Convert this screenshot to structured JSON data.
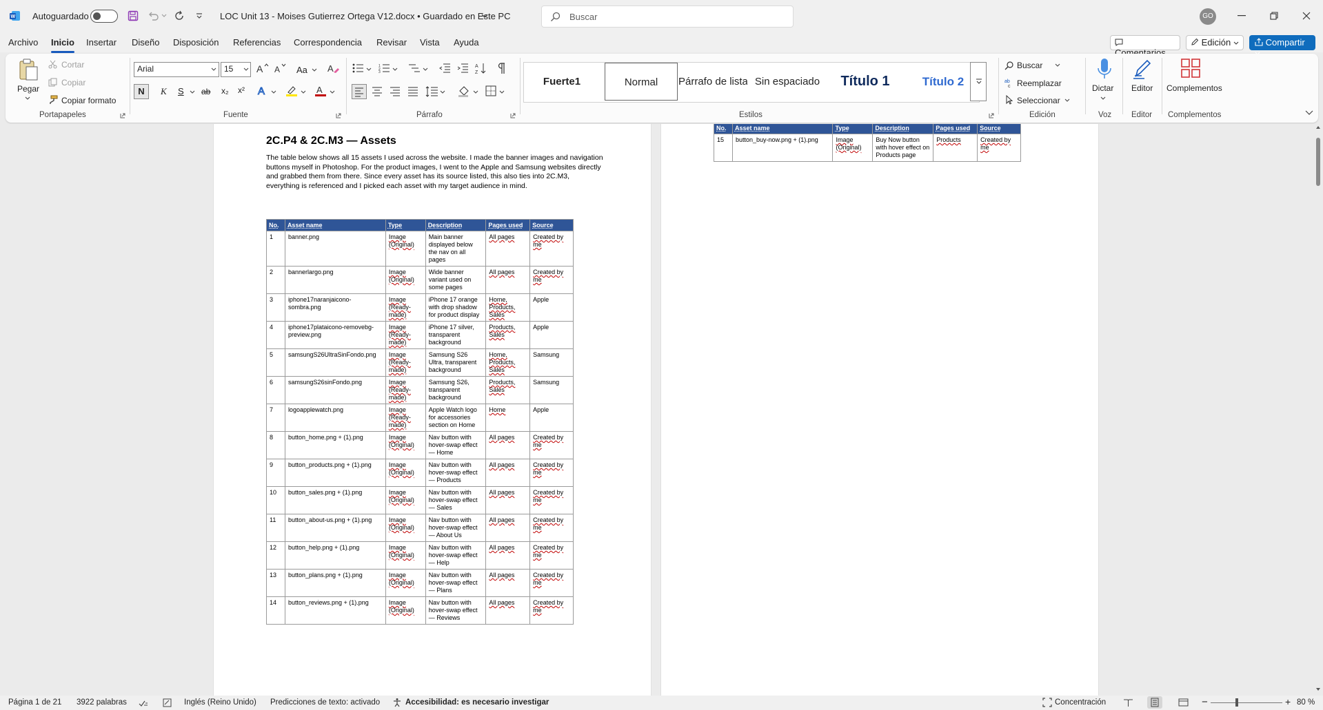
{
  "titlebar": {
    "autosave_label": "Autoguardado",
    "doc_title": "LOC Unit 13 - Moises Gutierrez Ortega V12.docx • Guardado en Este PC",
    "search_placeholder": "Buscar",
    "avatar_initials": "GO"
  },
  "menu": {
    "items": [
      "Archivo",
      "Inicio",
      "Insertar",
      "Diseño",
      "Disposición",
      "Referencias",
      "Correspondencia",
      "Revisar",
      "Vista",
      "Ayuda"
    ],
    "comments": "Comentarios",
    "editing": "Edición",
    "share": "Compartir"
  },
  "ribbon": {
    "paste": "Pegar",
    "cut": "Cortar",
    "copy": "Copiar",
    "format_painter": "Copiar formato",
    "group_clipboard": "Portapapeles",
    "font_name": "Arial",
    "font_size": "15",
    "change_case": "Aa",
    "bold": "N",
    "italic": "K",
    "underline": "S",
    "strike": "ab",
    "subscript": "x₂",
    "superscript": "x²",
    "group_font": "Fuente",
    "group_paragraph": "Párrafo",
    "styles": [
      "Fuerte1",
      "Normal",
      "Párrafo de lista",
      "Sin espaciado",
      "Título 1",
      "Título 2"
    ],
    "group_styles": "Estilos",
    "find": "Buscar",
    "replace": "Reemplazar",
    "select": "Seleccionar",
    "group_editing": "Edición",
    "dictate": "Dictar",
    "group_voice": "Voz",
    "editor": "Editor",
    "group_editor": "Editor",
    "addins": "Complementos",
    "group_addins": "Complementos"
  },
  "document": {
    "heading": "2C.P4 & 2C.M3 — Assets",
    "paragraph": "The table below shows all 15 assets I used across the website. I made the banner images and navigation buttons myself in Photoshop. For the product images, I went to the Apple and Samsung websites directly and grabbed them from there. Since every asset has its source listed, this also ties into 2C.M3, everything is referenced and I picked each asset with my target audience in mind.",
    "table_headers": [
      "No.",
      "Asset name",
      "Type",
      "Description",
      "Pages used",
      "Source"
    ],
    "rows": [
      [
        "1",
        "banner.png",
        "Image (Original)",
        "Main banner displayed below the nav on all pages",
        "All pages",
        "Created by me"
      ],
      [
        "2",
        "bannerlargo.png",
        "Image (Original)",
        "Wide banner variant used on some pages",
        "All pages",
        "Created by me"
      ],
      [
        "3",
        "iphone17naranjaicono-sombra.png",
        "Image (Ready-made)",
        "iPhone 17 orange with drop shadow for product display",
        "Home, Products, Sales",
        "Apple"
      ],
      [
        "4",
        "iphone17plataicono-removebg-preview.png",
        "Image (Ready-made)",
        "iPhone 17 silver, transparent background",
        "Products, Sales",
        "Apple"
      ],
      [
        "5",
        "samsungS26UltraSinFondo.png",
        "Image (Ready-made)",
        "Samsung S26 Ultra, transparent background",
        "Home, Products, Sales",
        "Samsung"
      ],
      [
        "6",
        "samsungS26sinFondo.png",
        "Image (Ready-made)",
        "Samsung S26, transparent background",
        "Products, Sales",
        "Samsung"
      ],
      [
        "7",
        "logoapplewatch.png",
        "Image (Ready-made)",
        "Apple Watch logo for accessories section on Home",
        "Home",
        "Apple"
      ],
      [
        "8",
        "button_home.png + (1).png",
        "Image (Original)",
        "Nav button with hover-swap effect — Home",
        "All pages",
        "Created by me"
      ],
      [
        "9",
        "button_products.png + (1).png",
        "Image (Original)",
        "Nav button with hover-swap effect — Products",
        "All pages",
        "Created by me"
      ],
      [
        "10",
        "button_sales.png + (1).png",
        "Image (Original)",
        "Nav button with hover-swap effect — Sales",
        "All pages",
        "Created by me"
      ],
      [
        "11",
        "button_about-us.png + (1).png",
        "Image (Original)",
        "Nav button with hover-swap effect — About Us",
        "All pages",
        "Created by me"
      ],
      [
        "12",
        "button_help.png + (1).png",
        "Image (Original)",
        "Nav button with hover-swap effect — Help",
        "All pages",
        "Created by me"
      ],
      [
        "13",
        "button_plans.png + (1).png",
        "Image (Original)",
        "Nav button with hover-swap effect — Plans",
        "All pages",
        "Created by me"
      ],
      [
        "14",
        "button_reviews.png + (1).png",
        "Image (Original)",
        "Nav button with hover-swap effect — Reviews",
        "All pages",
        "Created by me"
      ]
    ],
    "rows_page2": [
      [
        "15",
        "button_buy-now.png + (1).png",
        "Image (Original)",
        "Buy Now button with hover effect on Products page",
        "Products",
        "Created by me"
      ]
    ]
  },
  "status": {
    "page": "Página 1 de 21",
    "words": "3922 palabras",
    "language": "Inglés (Reino Unido)",
    "predictions": "Predicciones de texto: activado",
    "accessibility": "Accesibilidad: es necesario investigar",
    "focus": "Concentración",
    "zoom": "80 %"
  },
  "colors": {
    "accent": "#185abd",
    "share": "#0f6cbd",
    "table_header": "#2f5597"
  }
}
